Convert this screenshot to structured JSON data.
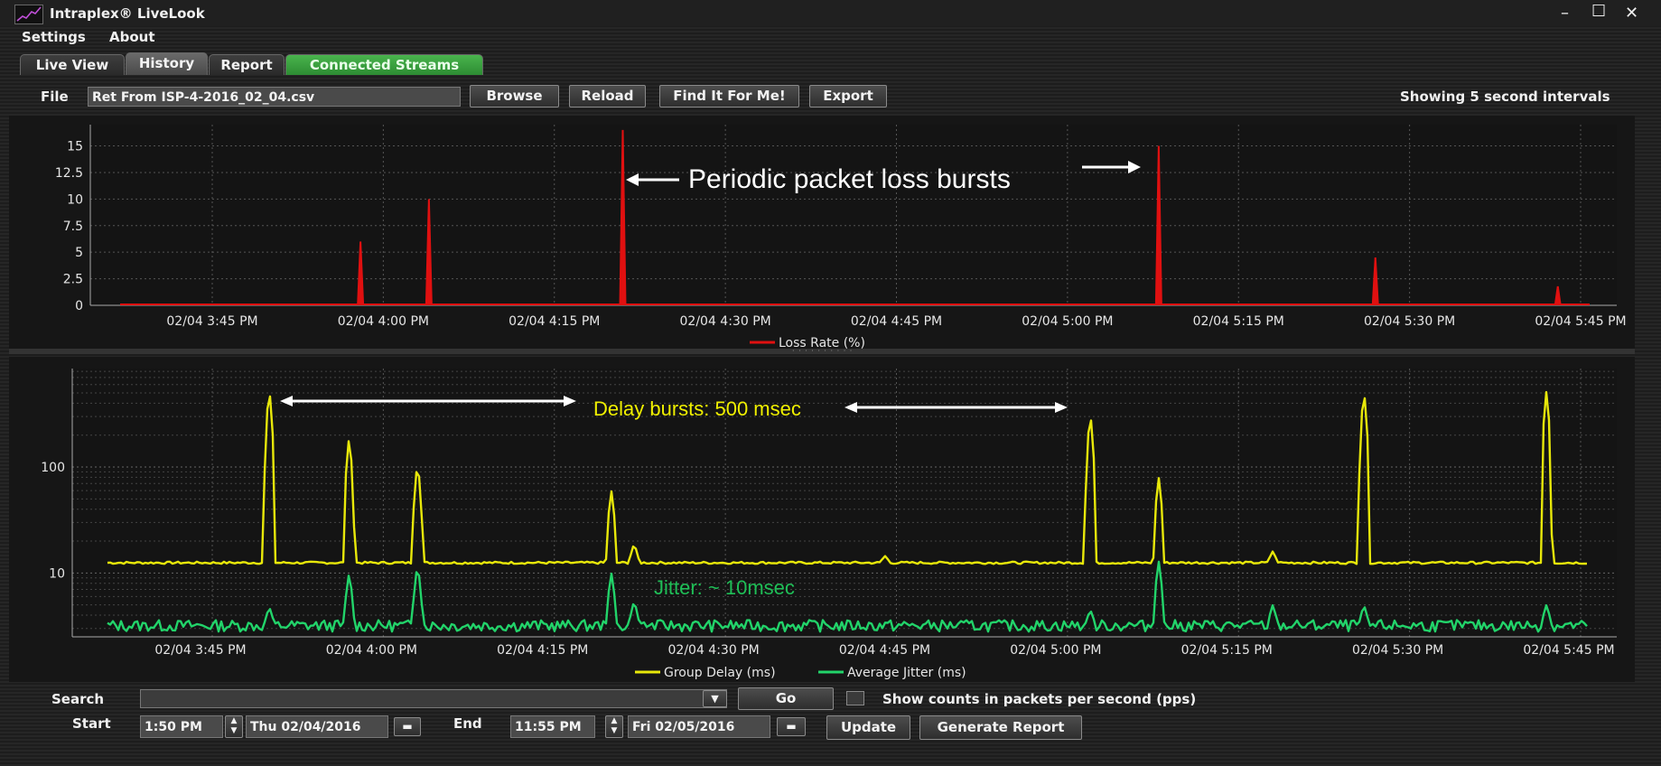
{
  "window": {
    "title": "Intraplex® LiveLook",
    "minimize": "–",
    "maximize": "☐",
    "close": "✕"
  },
  "menu": {
    "settings": "Settings",
    "about": "About"
  },
  "tabs": [
    {
      "label": "Live View"
    },
    {
      "label": "History",
      "active": true
    },
    {
      "label": "Report"
    },
    {
      "label": "Connected Streams",
      "color": "#3aa03f"
    }
  ],
  "file_row": {
    "label": "File",
    "value": "Ret From ISP-4-2016_02_04.csv",
    "browse": "Browse",
    "reload": "Reload",
    "find": "Find It For Me!",
    "export": "Export",
    "interval_text": "Showing 5 second intervals"
  },
  "chart_data": [
    {
      "type": "line",
      "x_ticks": [
        "02/04 3:45 PM",
        "02/04 4:00 PM",
        "02/04 4:15 PM",
        "02/04 4:30 PM",
        "02/04 4:45 PM",
        "02/04 5:00 PM",
        "02/04 5:15 PM",
        "02/04 5:30 PM",
        "02/04 5:45 PM"
      ],
      "y_ticks": [
        "0",
        "2.5",
        "5",
        "7.5",
        "10",
        "12.5",
        "15"
      ],
      "ylim": [
        0,
        17
      ],
      "series": [
        {
          "name": "Loss Rate (%)",
          "color": "#e01010",
          "baseline": 0,
          "spikes": [
            {
              "time": "02/04 3:58 PM",
              "value": 6
            },
            {
              "time": "02/04 4:04 PM",
              "value": 10
            },
            {
              "time": "02/04 4:21 PM",
              "value": 16.5
            },
            {
              "time": "02/04 5:08 PM",
              "value": 15
            },
            {
              "time": "02/04 5:27 PM",
              "value": 4.5
            },
            {
              "time": "02/04 5:43 PM",
              "value": 1.8
            }
          ]
        }
      ],
      "annotation": "Periodic packet loss bursts"
    },
    {
      "type": "line",
      "log_scale": true,
      "x_ticks": [
        "02/04 3:45 PM",
        "02/04 4:00 PM",
        "02/04 4:15 PM",
        "02/04 4:30 PM",
        "02/04 4:45 PM",
        "02/04 5:00 PM",
        "02/04 5:15 PM",
        "02/04 5:30 PM",
        "02/04 5:45 PM"
      ],
      "y_ticks": [
        "10",
        "100"
      ],
      "ylim": [
        2.5,
        850
      ],
      "series": [
        {
          "name": "Group Delay (ms)",
          "color": "#e8e80a",
          "baseline": 12.5,
          "spikes": [
            {
              "time": "02/04 3:50 PM",
              "value": 540
            },
            {
              "time": "02/04 3:57 PM",
              "value": 190
            },
            {
              "time": "02/04 4:03 PM",
              "value": 110
            },
            {
              "time": "02/04 4:20 PM",
              "value": 60
            },
            {
              "time": "02/04 4:22 PM",
              "value": 19
            },
            {
              "time": "02/04 4:44 PM",
              "value": 14.5
            },
            {
              "time": "02/04 5:02 PM",
              "value": 320
            },
            {
              "time": "02/04 5:08 PM",
              "value": 80
            },
            {
              "time": "02/04 5:18 PM",
              "value": 16
            },
            {
              "time": "02/04 5:26 PM",
              "value": 520
            },
            {
              "time": "02/04 5:42 PM",
              "value": 520
            }
          ]
        },
        {
          "name": "Average Jitter (ms)",
          "color": "#22d46a",
          "baseline": 3.2,
          "spikes": [
            {
              "time": "02/04 3:50 PM",
              "value": 4.8
            },
            {
              "time": "02/04 3:57 PM",
              "value": 10
            },
            {
              "time": "02/04 4:03 PM",
              "value": 12
            },
            {
              "time": "02/04 4:20 PM",
              "value": 10
            },
            {
              "time": "02/04 4:22 PM",
              "value": 5.5
            },
            {
              "time": "02/04 5:02 PM",
              "value": 4.5
            },
            {
              "time": "02/04 5:08 PM",
              "value": 13
            },
            {
              "time": "02/04 5:18 PM",
              "value": 5
            },
            {
              "time": "02/04 5:26 PM",
              "value": 5
            },
            {
              "time": "02/04 5:42 PM",
              "value": 5
            }
          ]
        }
      ],
      "annotations": [
        "Delay bursts: 500 msec",
        "Jitter: ~ 10msec"
      ]
    }
  ],
  "search_row": {
    "label": "Search",
    "value": "",
    "go": "Go",
    "pps_label": "Show counts in packets per second (pps)"
  },
  "range_row": {
    "start_label": "Start",
    "start_time": "1:50 PM",
    "start_date": "Thu 02/04/2016",
    "end_label": "End",
    "end_time": "11:55 PM",
    "end_date": "Fri 02/05/2016",
    "update": "Update",
    "generate": "Generate Report"
  }
}
